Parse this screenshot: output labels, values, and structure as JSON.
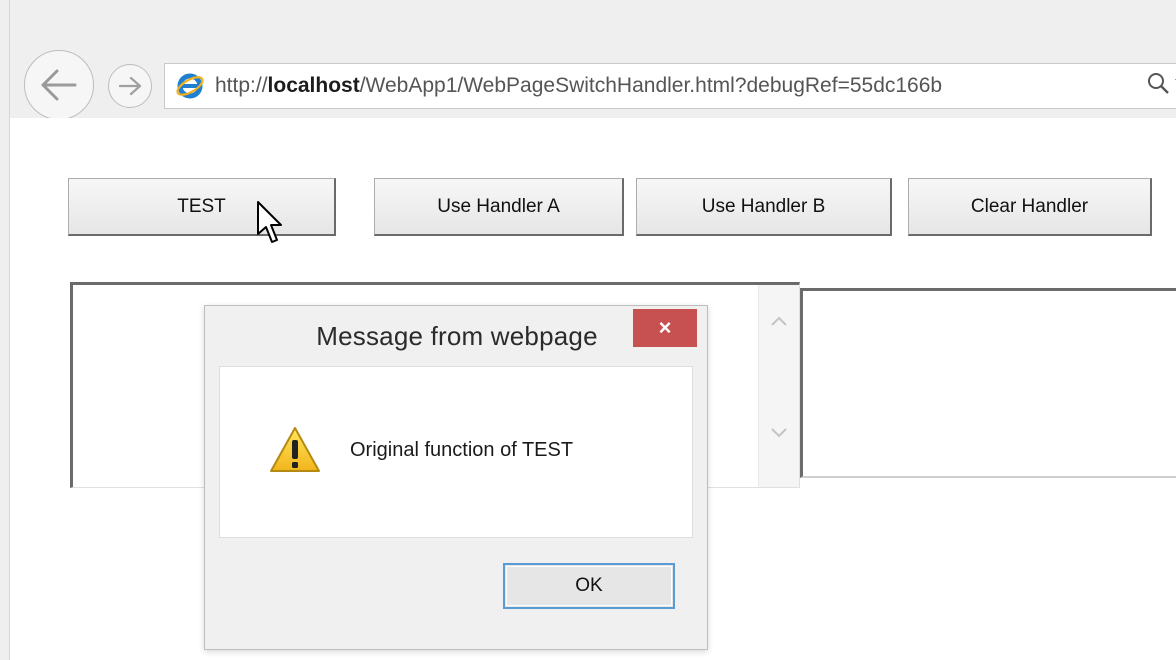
{
  "browser": {
    "url_prefix": "http://",
    "url_host": "localhost",
    "url_rest": "/WebApp1/WebPageSwitchHandler.html?debugRef=55dc166b",
    "icons": [
      "back-arrow-icon",
      "forward-arrow-icon",
      "ie-logo-icon",
      "search-icon",
      "dropdown-caret-icon"
    ]
  },
  "page": {
    "buttons": {
      "test": "TEST",
      "handler_a": "Use Handler A",
      "handler_b": "Use Handler B",
      "clear": "Clear Handler"
    }
  },
  "dialog": {
    "title": "Message from webpage",
    "close_glyph": "×",
    "message": "Original function of TEST",
    "ok_label": "OK",
    "icon": "warning-icon",
    "close_color": "#c75050"
  }
}
